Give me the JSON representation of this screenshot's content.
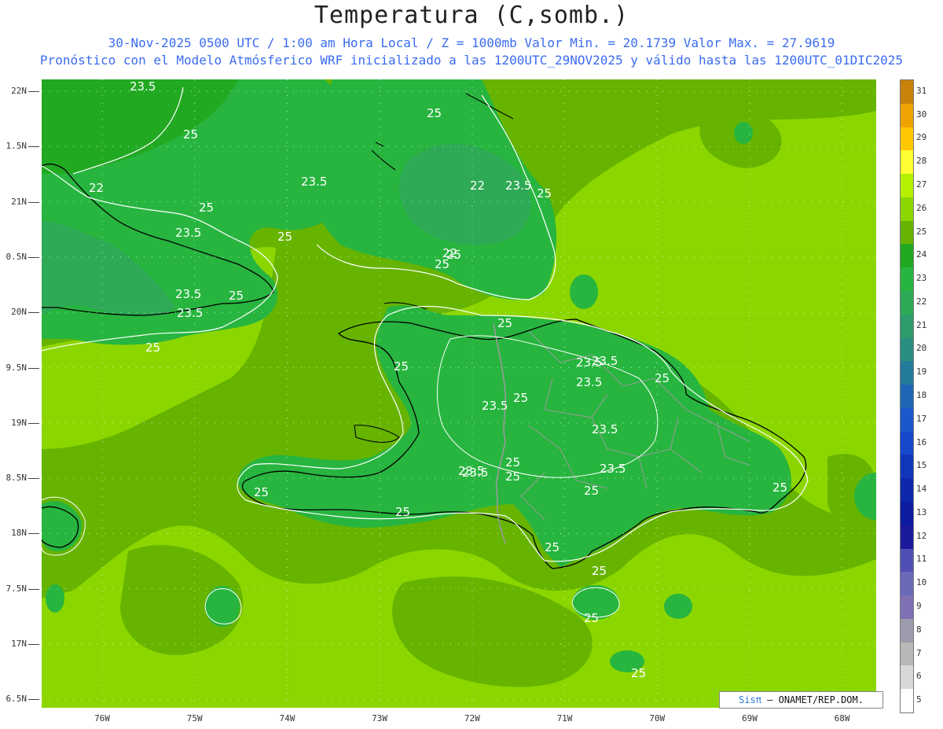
{
  "title": "Temperatura (C,somb.)",
  "subtitle1": "30-Nov-2025  0500 UTC / 1:00 am Hora Local / Z = 1000mb   Valor Min. = 20.1739  Valor Max. = 27.9619",
  "subtitle2": "Pronóstico con el Modelo Atmósferico WRF inicializado a las 1200UTC_29NOV2025 y válido hasta las  1200UTC_01DIC2025",
  "lat_labels": [
    "22N",
    "1.5N",
    "21N",
    "0.5N",
    "20N",
    "9.5N",
    "19N",
    "8.5N",
    "18N",
    "7.5N",
    "17N",
    "6.5N"
  ],
  "lon_labels": [
    "76W",
    "75W",
    "74W",
    "73W",
    "72W",
    "71W",
    "70W",
    "69W",
    "68W"
  ],
  "legend": {
    "labels": [
      "31",
      "30",
      "29",
      "28",
      "27",
      "26",
      "25",
      "24",
      "23",
      "22",
      "21",
      "20",
      "19",
      "18",
      "17",
      "16",
      "15",
      "14",
      "13",
      "12",
      "11",
      "10",
      "9",
      "8",
      "7",
      "6",
      "5"
    ],
    "colors": [
      "#c8820a",
      "#eea300",
      "#ffc700",
      "#ffff33",
      "#b4f000",
      "#8cd600",
      "#66b400",
      "#22a922",
      "#27b53f",
      "#2ea955",
      "#2e9c6b",
      "#2a8f80",
      "#237a99",
      "#1e67b6",
      "#1b58cc",
      "#1648cc",
      "#1236bb",
      "#0d28aa",
      "#0c1ba0",
      "#1a1a9a",
      "#5050b4",
      "#6a6ab8",
      "#8070b4",
      "#9c9cac",
      "#b8b8b8",
      "#d8d8d8",
      "#ffffff"
    ]
  },
  "contour_labels": [
    "23.5",
    "25",
    "22",
    "23.5",
    "25",
    "25",
    "23.5",
    "23.5",
    "23.5",
    "25",
    "25",
    "25",
    "23.5",
    "25",
    "22",
    "23.5",
    "25",
    "22",
    "23.5",
    "23.5",
    "25",
    "25",
    "25",
    "25",
    "23.5",
    "23.5",
    "25",
    "23.5",
    "25",
    "23.5",
    "23.5",
    "25",
    "25",
    "25",
    "25",
    "25",
    "25",
    "25",
    "25",
    "25"
  ],
  "credit": {
    "brand": "Sisπ",
    "text": " – ONAMET/REP.DOM."
  },
  "colors": {
    "accent": "#3a6cf0",
    "sea_light": "#8cd600",
    "land_mid": "#66b400",
    "land_dark": "#22a922"
  }
}
